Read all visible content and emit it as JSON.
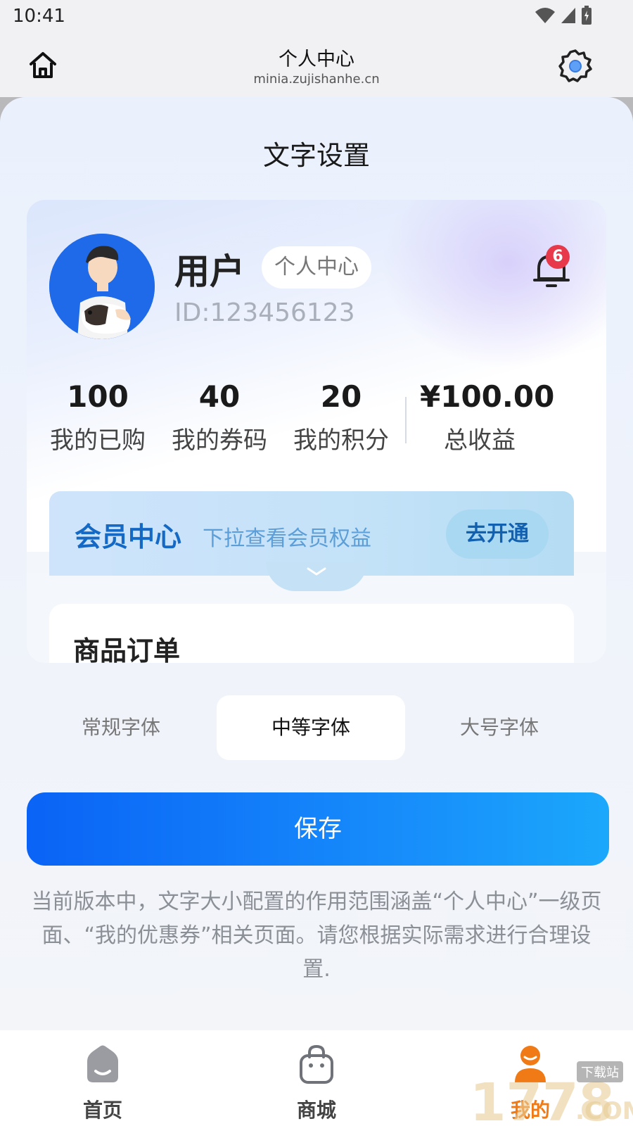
{
  "status_bar": {
    "time": "10:41"
  },
  "nav": {
    "title": "个人中心",
    "url": "minia.zujishanhe.cn"
  },
  "sheet": {
    "title": "文字设置"
  },
  "preview": {
    "username": "用户",
    "user_tag": "个人中心",
    "user_id": "ID:123456123",
    "notification_count": "6",
    "stats": [
      {
        "value": "100",
        "label": "我的已购"
      },
      {
        "value": "40",
        "label": "我的券码"
      },
      {
        "value": "20",
        "label": "我的积分"
      },
      {
        "value": "¥100.00",
        "label": "总收益"
      }
    ],
    "vip": {
      "title": "会员中心",
      "subtitle": "下拉查看会员权益",
      "button": "去开通"
    },
    "order_card_title": "商品订单"
  },
  "font_options": {
    "items": [
      "常规字体",
      "中等字体",
      "大号字体"
    ],
    "selected": "中等字体"
  },
  "save_button": "保存",
  "note": "当前版本中，文字大小配置的作用范围涵盖“个人中心”一级页面、“我的优惠券”相关页面。请您根据实际需求进行合理设置.",
  "tabbar": {
    "items": [
      {
        "label": "首页",
        "icon": "home-icon"
      },
      {
        "label": "商城",
        "icon": "shopping-bag-icon"
      },
      {
        "label": "我的",
        "icon": "user-icon",
        "active": true
      }
    ],
    "active_color": "#f07a16"
  },
  "colors": {
    "accent": "#0a63f6",
    "vip_text": "#1469c5",
    "badge": "#e7394a"
  },
  "watermark_text": "1778.COM 下载站"
}
